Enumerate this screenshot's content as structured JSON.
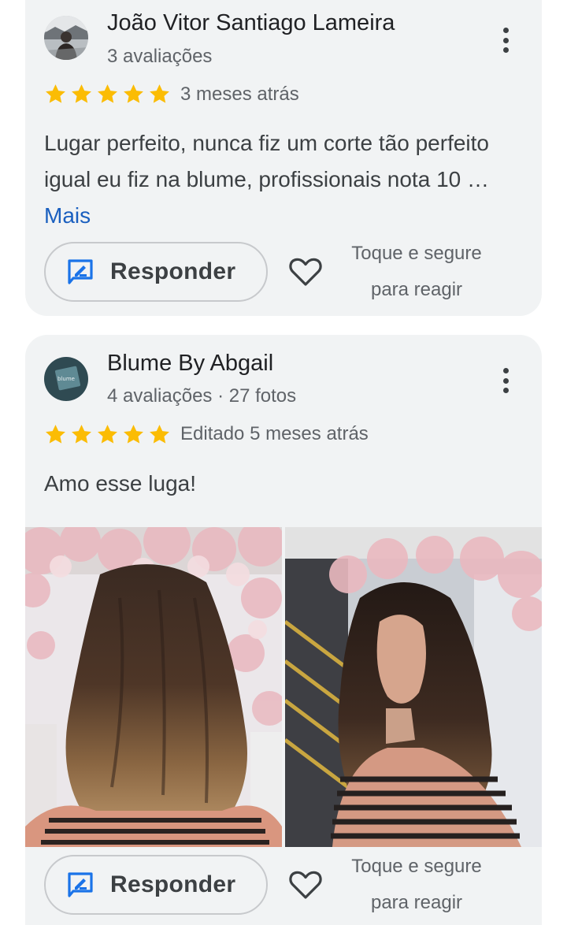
{
  "reviews": [
    {
      "author": "João Vitor Santiago Lameira",
      "stats": "3 avaliações",
      "rating": 5,
      "time": "3 meses atrás",
      "text": "Lugar perfeito, nunca fiz um corte tão perfeito igual eu fiz na blume, profissionais nota 10 …",
      "more_label": "Mais",
      "reply_label": "Responder",
      "react_hint_line1": "Toque e segure",
      "react_hint_line2": "para reagir"
    },
    {
      "author": "Blume By Abgail",
      "stats": "4 avaliações · 27 fotos",
      "rating": 5,
      "time": "Editado 5 meses atrás",
      "text": "Amo esse luga!",
      "reply_label": "Responder",
      "react_hint_line1": "Toque e segure",
      "react_hint_line2": "para reagir"
    }
  ],
  "colors": {
    "star": "#fbbc04",
    "link": "#1a5fbf",
    "reply_icon": "#1a73e8",
    "card_bg": "#f1f3f4"
  },
  "icons": {
    "menu": "more-vert-icon",
    "reply": "reply-edit-icon",
    "react": "heart-outline-icon",
    "rating": "star-icon"
  }
}
